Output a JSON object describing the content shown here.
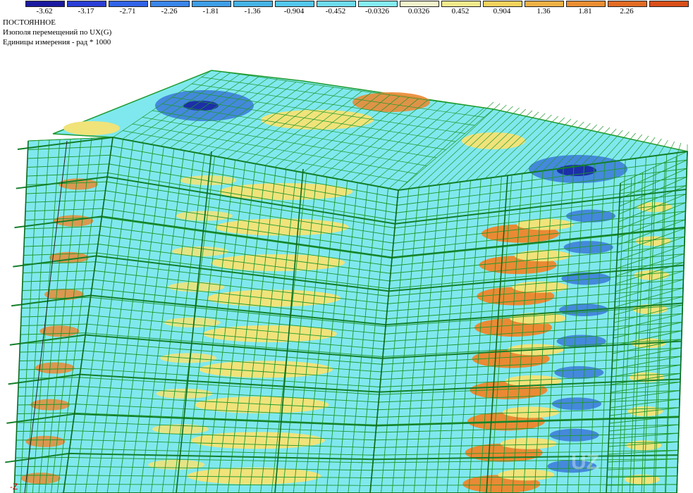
{
  "legend": {
    "tick_labels": [
      "-3.62",
      "-3.17",
      "-2.71",
      "-2.26",
      "-1.81",
      "-1.36",
      "-0.904",
      "-0.452",
      "-0.0326",
      "0.0326",
      "0.452",
      "0.904",
      "1.36",
      "1.81",
      "2.26"
    ],
    "colors": [
      "#1a1aa0",
      "#2b3fd6",
      "#3264e8",
      "#3a86ea",
      "#3f9ee6",
      "#45b4e6",
      "#55c8ec",
      "#6fdcef",
      "#86ecf3",
      "#f2f2cc",
      "#f3ea8e",
      "#f4d35e",
      "#f0b246",
      "#ea8e33",
      "#e36b24",
      "#d94f1a"
    ]
  },
  "info": {
    "case_name": "ПОСТОЯННОЕ",
    "field_title": "Изополя  перемещений по UX(G)",
    "units": "Единицы измерения - рад * 1000"
  },
  "axis": {
    "label": "-Z"
  },
  "watermark": "UZ",
  "palette": {
    "mesh": "#1f9a2e",
    "base": "#7fe8ee",
    "blue": "#3a78d8",
    "dark_blue": "#1c2fa8",
    "yellow": "#f0e37a",
    "orange": "#ea8a34",
    "pale": "#e8f8f0"
  }
}
